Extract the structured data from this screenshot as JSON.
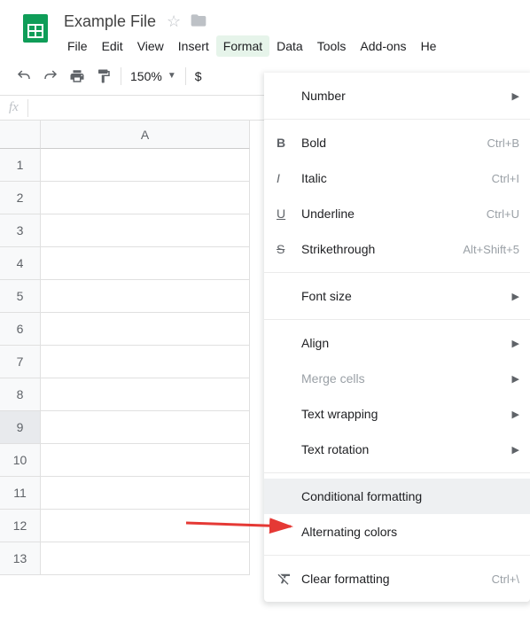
{
  "doc": {
    "title": "Example File"
  },
  "menubar": [
    "File",
    "Edit",
    "View",
    "Insert",
    "Format",
    "Data",
    "Tools",
    "Add-ons",
    "He"
  ],
  "active_menu": "Format",
  "toolbar": {
    "zoom": "150%",
    "currency": "$"
  },
  "fx_label": "fx",
  "columns": [
    "A"
  ],
  "rows": [
    "1",
    "2",
    "3",
    "4",
    "5",
    "6",
    "7",
    "8",
    "9",
    "10",
    "11",
    "12",
    "13"
  ],
  "selected_row_index": 8,
  "dropdown": {
    "number": "Number",
    "bold": {
      "label": "Bold",
      "short": "Ctrl+B"
    },
    "italic": {
      "label": "Italic",
      "short": "Ctrl+I"
    },
    "underline": {
      "label": "Underline",
      "short": "Ctrl+U"
    },
    "strike": {
      "label": "Strikethrough",
      "short": "Alt+Shift+5"
    },
    "fontsize": "Font size",
    "align": "Align",
    "merge": "Merge cells",
    "wrap": "Text wrapping",
    "rotate": "Text rotation",
    "cond": "Conditional formatting",
    "alt": "Alternating colors",
    "clear": {
      "label": "Clear formatting",
      "short": "Ctrl+\\"
    }
  }
}
